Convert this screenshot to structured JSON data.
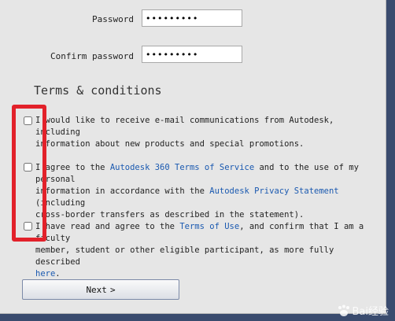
{
  "form": {
    "password_label": "Password",
    "password_value": "•••••••••",
    "confirm_label": "Confirm password",
    "confirm_value": "•••••••••"
  },
  "terms": {
    "title": "Terms & conditions",
    "item1": {
      "line1": "I would like to receive e-mail communications from Autodesk, including",
      "line2": "information about new products and special promotions."
    },
    "item2": {
      "pre": "I agree to the ",
      "link1": "Autodesk 360 Terms of Service",
      "mid1": " and to the use of my personal",
      "line2_pre": "information in accordance with the ",
      "link2": "Autodesk Privacy Statement",
      "line2_post": " (including",
      "line3": "cross-border transfers as described in the statement)."
    },
    "item3": {
      "pre": "I have read and agree to the ",
      "link1": "Terms of Use",
      "post": ", and confirm that I am a faculty",
      "line2": "member, student or other eligible participant, as more fully described",
      "link2": "here",
      "end": "."
    }
  },
  "buttons": {
    "next_label": "Next",
    "next_icon": ">"
  },
  "watermark": {
    "text": "Bai经验"
  }
}
